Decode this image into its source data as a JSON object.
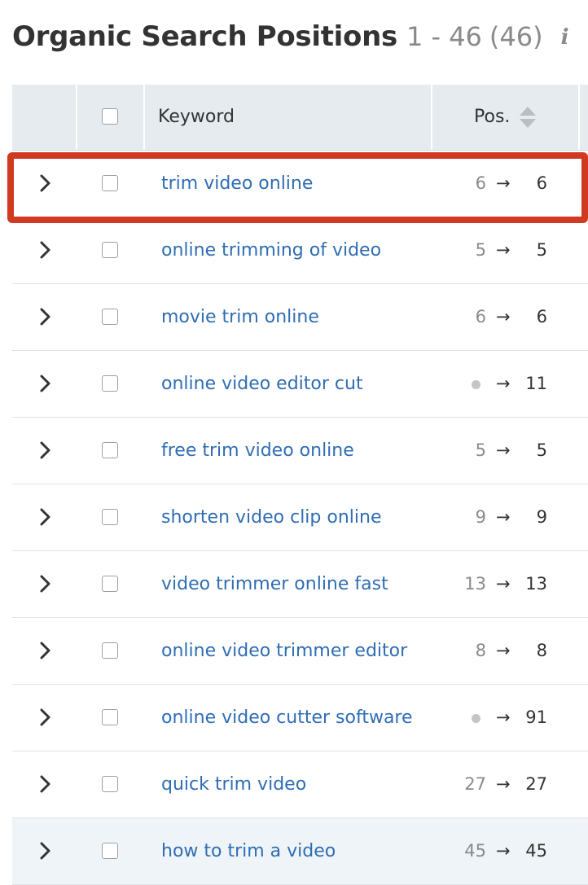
{
  "header": {
    "title": "Organic Search Positions",
    "range": "1 - 46",
    "count": "(46)",
    "info_icon": "info-icon"
  },
  "table": {
    "columns": {
      "keyword": "Keyword",
      "position": "Pos."
    },
    "arrow_glyph": "→",
    "rows": [
      {
        "keyword": "trim video online",
        "prev": "6",
        "curr": "6",
        "prev_is_new": false,
        "highlighted": true
      },
      {
        "keyword": "online trimming of video",
        "prev": "5",
        "curr": "5",
        "prev_is_new": false
      },
      {
        "keyword": "movie trim online",
        "prev": "6",
        "curr": "6",
        "prev_is_new": false
      },
      {
        "keyword": "online video editor cut",
        "prev": "",
        "curr": "11",
        "prev_is_new": true
      },
      {
        "keyword": "free trim video online",
        "prev": "5",
        "curr": "5",
        "prev_is_new": false
      },
      {
        "keyword": "shorten video clip online",
        "prev": "9",
        "curr": "9",
        "prev_is_new": false
      },
      {
        "keyword": "video trimmer online fast",
        "prev": "13",
        "curr": "13",
        "prev_is_new": false
      },
      {
        "keyword": "online video trimmer editor",
        "prev": "8",
        "curr": "8",
        "prev_is_new": false
      },
      {
        "keyword": "online video cutter software",
        "prev": "",
        "curr": "91",
        "prev_is_new": true
      },
      {
        "keyword": "quick trim video",
        "prev": "27",
        "curr": "27",
        "prev_is_new": false
      },
      {
        "keyword": "how to trim a video",
        "prev": "45",
        "curr": "45",
        "prev_is_new": false,
        "hovered": true
      }
    ]
  },
  "colors": {
    "keyword_link": "#2f6db3",
    "header_bg": "#e6ebef",
    "highlight_border": "#cf3a21",
    "muted_text": "#8a8a8a"
  }
}
